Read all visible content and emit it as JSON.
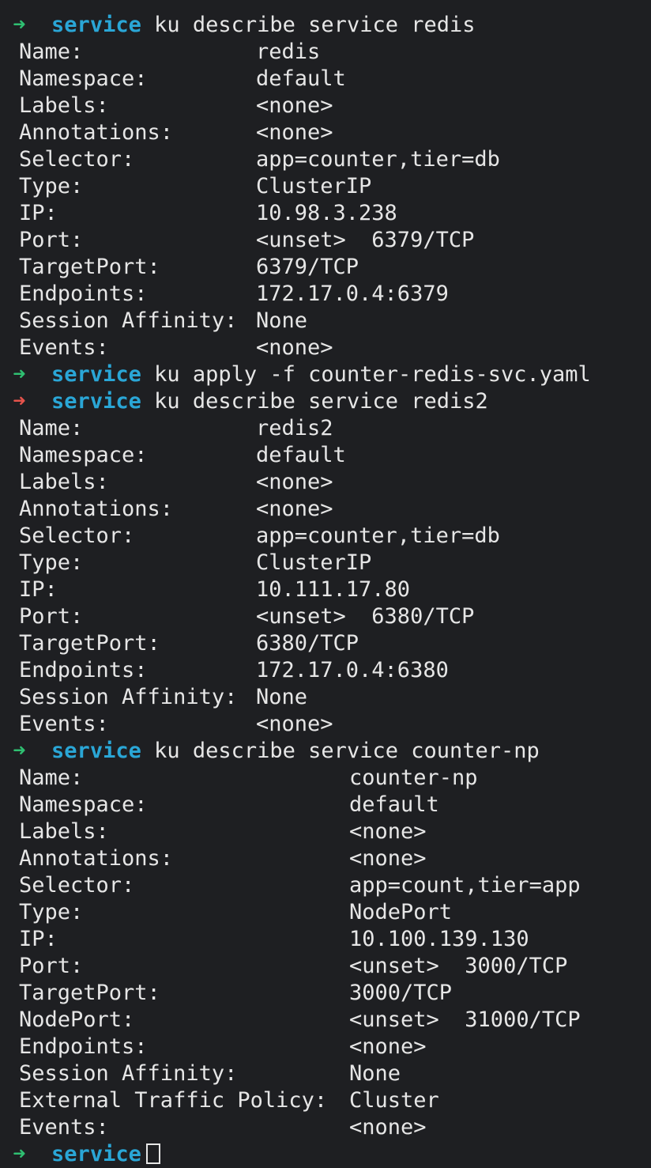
{
  "terminal": {
    "partial_top_line": "  ",
    "blocks": [
      {
        "prompt_status": "ok",
        "directory": "service",
        "command": "ku describe service redis",
        "fields": [
          {
            "label": "Name:",
            "value": "redis"
          },
          {
            "label": "Namespace:",
            "value": "default"
          },
          {
            "label": "Labels:",
            "value": "<none>"
          },
          {
            "label": "Annotations:",
            "value": "<none>"
          },
          {
            "label": "Selector:",
            "value": "app=counter,tier=db"
          },
          {
            "label": "Type:",
            "value": "ClusterIP"
          },
          {
            "label": "IP:",
            "value": "10.98.3.238"
          },
          {
            "label": "Port:",
            "value": "<unset>  6379/TCP"
          },
          {
            "label": "TargetPort:",
            "value": "6379/TCP"
          },
          {
            "label": "Endpoints:",
            "value": "172.17.0.4:6379"
          },
          {
            "label": "Session Affinity:",
            "value": "None"
          },
          {
            "label": "Events:",
            "value": "<none>"
          }
        ]
      },
      {
        "prompt_status": "ok",
        "directory": "service",
        "command": "ku apply -f counter-redis-svc.yaml",
        "fields": []
      },
      {
        "prompt_status": "error",
        "directory": "service",
        "command": "ku describe service redis2",
        "fields": [
          {
            "label": "Name:",
            "value": "redis2"
          },
          {
            "label": "Namespace:",
            "value": "default"
          },
          {
            "label": "Labels:",
            "value": "<none>"
          },
          {
            "label": "Annotations:",
            "value": "<none>"
          },
          {
            "label": "Selector:",
            "value": "app=counter,tier=db"
          },
          {
            "label": "Type:",
            "value": "ClusterIP"
          },
          {
            "label": "IP:",
            "value": "10.111.17.80"
          },
          {
            "label": "Port:",
            "value": "<unset>  6380/TCP"
          },
          {
            "label": "TargetPort:",
            "value": "6380/TCP"
          },
          {
            "label": "Endpoints:",
            "value": "172.17.0.4:6380"
          },
          {
            "label": "Session Affinity:",
            "value": "None"
          },
          {
            "label": "Events:",
            "value": "<none>"
          }
        ]
      },
      {
        "prompt_status": "ok",
        "directory": "service",
        "command": "ku describe service counter-np",
        "fields": [
          {
            "label": "Name:",
            "value": "counter-np"
          },
          {
            "label": "Namespace:",
            "value": "default"
          },
          {
            "label": "Labels:",
            "value": "<none>"
          },
          {
            "label": "Annotations:",
            "value": "<none>"
          },
          {
            "label": "Selector:",
            "value": "app=count,tier=app"
          },
          {
            "label": "Type:",
            "value": "NodePort"
          },
          {
            "label": "IP:",
            "value": "10.100.139.130"
          },
          {
            "label": "Port:",
            "value": "<unset>  3000/TCP"
          },
          {
            "label": "TargetPort:",
            "value": "3000/TCP"
          },
          {
            "label": "NodePort:",
            "value": "<unset>  31000/TCP"
          },
          {
            "label": "Endpoints:",
            "value": "<none>"
          },
          {
            "label": "Session Affinity:",
            "value": "None"
          },
          {
            "label": "External Traffic Policy:",
            "value": "Cluster"
          },
          {
            "label": "Events:",
            "value": "<none>"
          }
        ]
      }
    ],
    "final_prompt": {
      "prompt_status": "ok",
      "directory": "service"
    },
    "prompt_arrow": "➜",
    "colors": {
      "background": "#1e1f22",
      "text": "#e6e6e6",
      "ok_arrow": "#2fbf71",
      "error_arrow": "#e5534b",
      "directory": "#2aa6d6"
    }
  }
}
